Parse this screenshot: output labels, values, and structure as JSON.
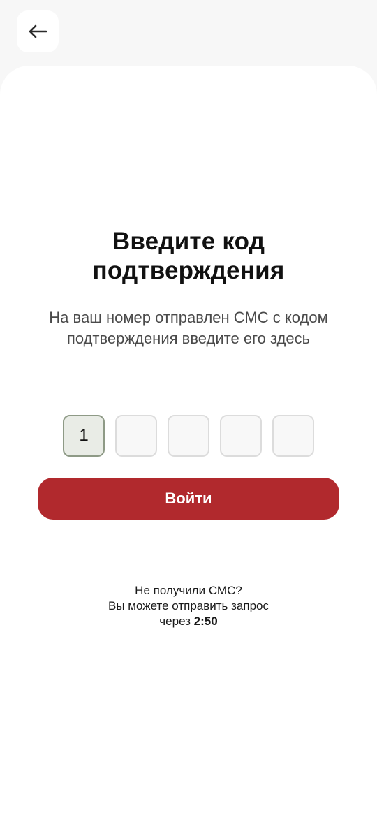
{
  "header": {
    "back_icon": "arrow-left-icon"
  },
  "title": {
    "line1": "Введите код",
    "line2": "подтверждения"
  },
  "subtitle": {
    "line1": "На ваш номер отправлен СМС с кодом",
    "line2": "подтверждения введите его здесь"
  },
  "code": {
    "digits": [
      "1",
      "",
      "",
      "",
      ""
    ]
  },
  "login_button": {
    "label": "Войти"
  },
  "resend": {
    "line1": "Не получили СМС?",
    "line2": "Вы можете отправить запрос",
    "line3_prefix": "через ",
    "timer": "2:50"
  },
  "colors": {
    "accent": "#b1292d",
    "filled_cell_bg": "#e9ece6",
    "filled_cell_border": "#8e9a86"
  }
}
